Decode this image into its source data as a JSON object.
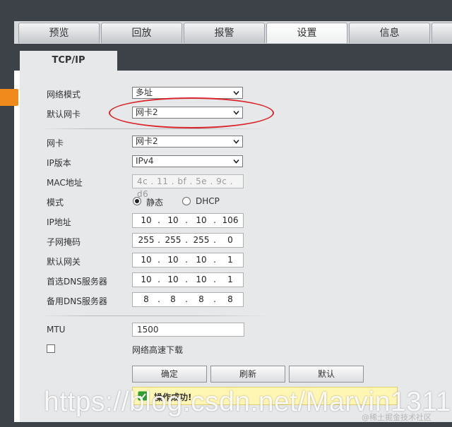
{
  "nav": {
    "tabs": [
      {
        "label": "预览",
        "active": false
      },
      {
        "label": "回放",
        "active": false
      },
      {
        "label": "报警",
        "active": false
      },
      {
        "label": "设置",
        "active": true
      },
      {
        "label": "信息",
        "active": false
      }
    ]
  },
  "subtab": {
    "label": "TCP/IP"
  },
  "form": {
    "network_mode": {
      "label": "网络模式",
      "value": "多址"
    },
    "default_nic": {
      "label": "默认网卡",
      "value": "网卡2"
    },
    "nic": {
      "label": "网卡",
      "value": "网卡2"
    },
    "ip_version": {
      "label": "IP版本",
      "value": "IPv4"
    },
    "mac": {
      "label": "MAC地址",
      "value": "4c . 11 . bf . 5e . 9c . d6"
    },
    "mode": {
      "label": "模式",
      "options": [
        {
          "label": "静态",
          "checked": true
        },
        {
          "label": "DHCP",
          "checked": false
        }
      ]
    },
    "ip_address": {
      "label": "IP地址",
      "octets": [
        "10",
        "10",
        "10",
        "106"
      ]
    },
    "subnet_mask": {
      "label": "子网掩码",
      "octets": [
        "255",
        "255",
        "255",
        "0"
      ]
    },
    "gateway": {
      "label": "默认网关",
      "octets": [
        "10",
        "10",
        "10",
        "1"
      ]
    },
    "preferred_dns": {
      "label": "首选DNS服务器",
      "octets": [
        "10",
        "10",
        "10",
        "1"
      ]
    },
    "alternate_dns": {
      "label": "备用DNS服务器",
      "octets": [
        "8",
        "8",
        "8",
        "8"
      ]
    },
    "mtu": {
      "label": "MTU",
      "value": "1500"
    },
    "high_speed_download": {
      "label": "网络高速下载",
      "checked": false
    }
  },
  "buttons": {
    "confirm": "确定",
    "refresh": "刷新",
    "default": "默认"
  },
  "status": {
    "message": "操作成功!",
    "icon": "check-icon",
    "color": "#2e9e2e"
  },
  "annotation": {
    "color": "#d9262c"
  },
  "watermark": {
    "main": "https://blog.csdn.net/Marvin1311",
    "small": "@稀土掘金技术社区"
  }
}
